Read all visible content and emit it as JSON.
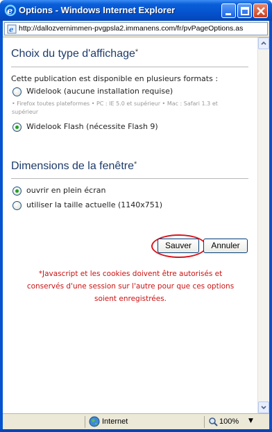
{
  "window": {
    "title": "Options - Windows Internet Explorer",
    "icon": "ie-icon"
  },
  "address_bar": {
    "url": "http://dallozvernimmen-pvgpsla2.immanens.com/fr/pvPageOptions.as"
  },
  "section_display": {
    "title": "Choix du type d'affichage",
    "star": "*",
    "intro": "Cette publication est disponible en plusieurs formats :",
    "option_widelook": "Widelook",
    "option_widelook_note": "(aucune installation requise)",
    "widelook_requirements_line1": "• Firefox toutes plateformes • PC : IE 5.0 et supérieur • Mac : Safari 1.3 et",
    "widelook_requirements_line2": "supérieur",
    "option_flash": "Widelook Flash",
    "option_flash_note": "(nécessite Flash 9)",
    "selected": "Widelook Flash"
  },
  "section_window": {
    "title": "Dimensions de la fenêtre",
    "star": "*",
    "option_fullscreen": "ouvrir en plein écran",
    "option_current": "utiliser la taille actuelle (1140x751)",
    "selected": "ouvrir en plein écran"
  },
  "buttons": {
    "save": "Sauver",
    "cancel": "Annuler"
  },
  "note": {
    "line1": "*Javascript et les cookies doivent être autorisés et",
    "line2": "conservés d'une session sur l'autre pour que ces options",
    "line3": "soient enregistrées."
  },
  "status_bar": {
    "zone": "Internet",
    "zoom": "100%"
  },
  "colors": {
    "title_bar": "#0553cf",
    "section_title": "#1d3a6a",
    "note_text": "#cc1111",
    "highlight_ring": "#d8141c",
    "radio_selected": "#21a121"
  }
}
